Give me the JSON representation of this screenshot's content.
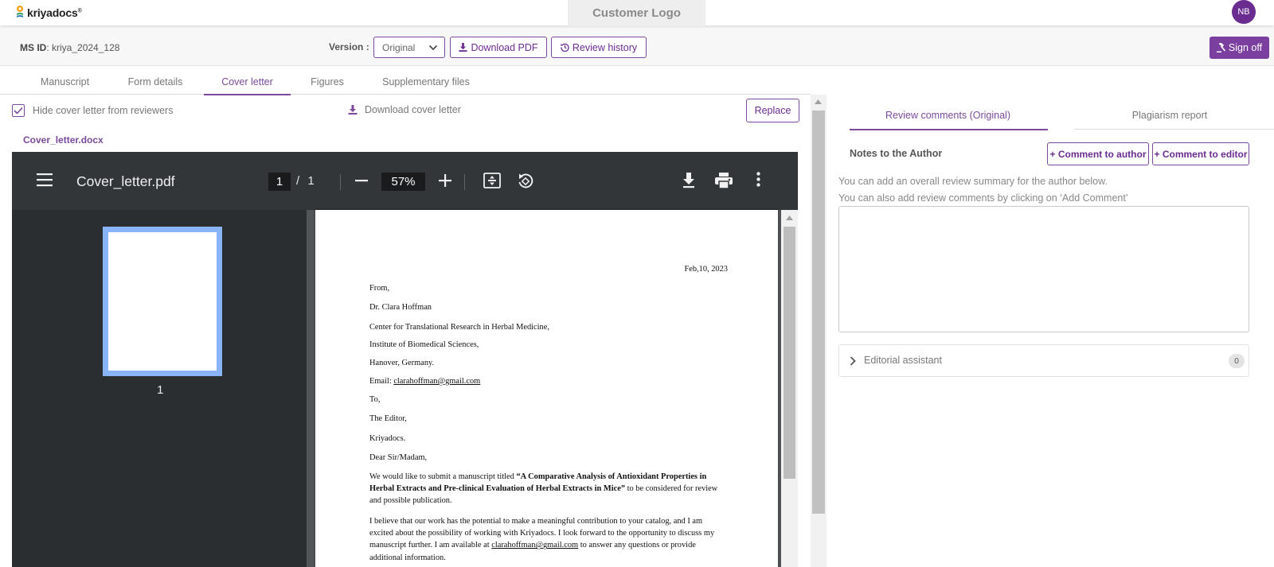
{
  "header": {
    "brand": "kriyadocs",
    "brand_reg": "®",
    "customer_logo": "Customer Logo",
    "avatar_initials": "NB"
  },
  "toolbar": {
    "ms_id_label": "MS ID",
    "ms_id_value": ": kriya_2024_128",
    "version_label": "Version :",
    "version_selected": "Original",
    "download_pdf": "Download PDF",
    "review_history": "Review history",
    "sign_off": "Sign off"
  },
  "tabs": [
    {
      "label": "Manuscript"
    },
    {
      "label": "Form details"
    },
    {
      "label": "Cover letter",
      "active": true
    },
    {
      "label": "Figures"
    },
    {
      "label": "Supplementary files"
    }
  ],
  "cover": {
    "hide_label": "Hide cover letter from reviewers",
    "hide_checked": true,
    "download_label": "Download cover letter",
    "replace_label": "Replace",
    "file_name": "Cover_letter.docx"
  },
  "pdf": {
    "title": "Cover_letter.pdf",
    "current_page": "1",
    "page_total": "/ 1",
    "zoom": "57%",
    "thumb_number": "1"
  },
  "letter": {
    "date": "Feb,10, 2023",
    "from": "From,",
    "name": "Dr. Clara Hoffman",
    "center": "Center for Translational Research in Herbal Medicine,",
    "institute": "Institute of Biomedical Sciences,",
    "city": "Hanover, Germany.",
    "email_label": "Email: ",
    "email": "clarahoffman@gmail.com",
    "to": "To,",
    "editor": "The Editor,",
    "org": "Kriyadocs.",
    "salutation": "Dear Sir/Madam,",
    "p1_pre": "We would like to submit a manuscript titled ",
    "p1_title": "“A Comparative Analysis of Antioxidant Properties in Herbal Extracts and Pre-clinical Evaluation of Herbal Extracts in Mice”",
    "p1_post": " to be considered for review and possible publication.",
    "p2_pre": "I believe that our work has the potential to make a meaningful contribution to your catalog, and I am excited about the possibility of working with Kriyadocs. I look forward to the opportunity to discuss my manuscript further. I am available at ",
    "p2_email": "clarahoffman@gmail.com",
    "p2_post": " to answer any questions or provide additional information."
  },
  "right": {
    "tab_review": "Review comments (Original)",
    "tab_plagiarism": "Plagiarism report",
    "notes_title": "Notes to the Author",
    "comment_author": "+ Comment to author",
    "comment_editor": "+ Comment to editor",
    "hint1": "You can add an overall review summary for the author below.",
    "hint2": "You can also add review comments by clicking on ‘Add Comment’",
    "notes_value": "",
    "editorial_assistant": "Editorial assistant",
    "editorial_count": "0"
  },
  "colors": {
    "accent": "#7b4a9c",
    "signoff_bg": "#7b3fa0",
    "avatar_bg": "#6b2c91",
    "pdf_toolbar": "#323639",
    "thumb_highlight": "#8ab4f8"
  },
  "icons": [
    "kriyadocs-logo-icon",
    "chevron-down-icon",
    "download-icon",
    "history-icon",
    "gavel-icon",
    "checkbox-checked-icon",
    "hamburger-menu-icon",
    "zoom-out-icon",
    "zoom-in-icon",
    "fit-page-icon",
    "rotate-icon",
    "print-icon",
    "more-vert-icon",
    "chevron-right-icon",
    "scroll-up-arrow-icon"
  ]
}
